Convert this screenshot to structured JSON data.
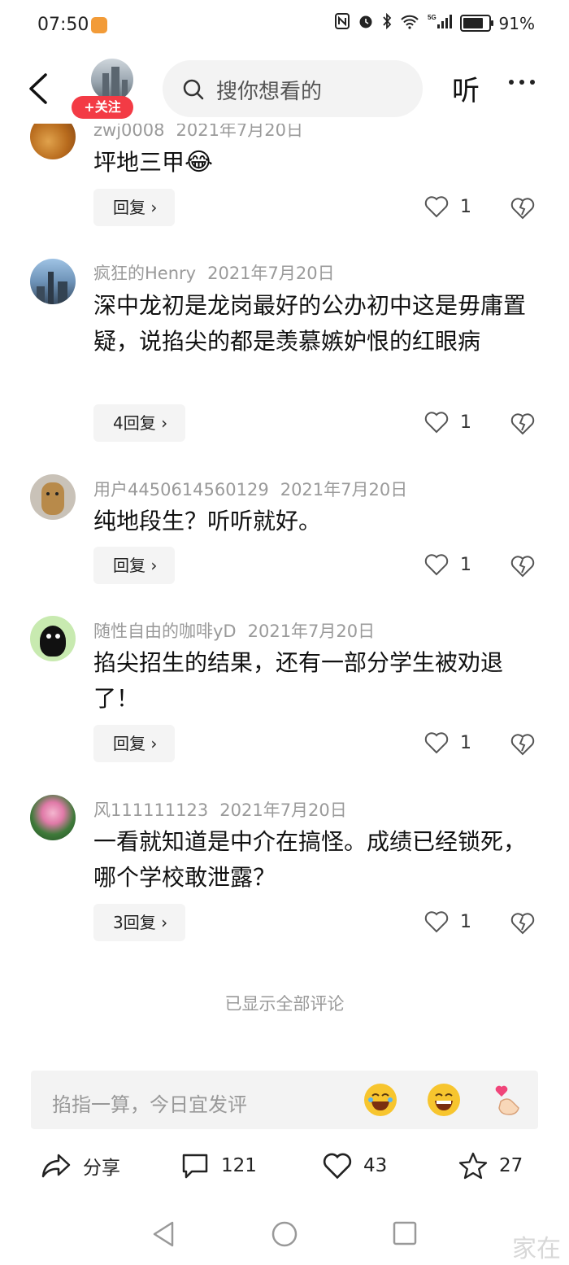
{
  "status_bar": {
    "time": "07:50",
    "battery": "91%",
    "battery_level": 0.91,
    "network": "5G"
  },
  "header": {
    "follow_label": "+关注",
    "search_placeholder": "搜你想看的",
    "listen_label": "听"
  },
  "comments": [
    {
      "user": "zwj0008",
      "date": "2021年7月20日",
      "text": "坪地三甲",
      "reply_label": "回复",
      "likes": "1",
      "emoji": "😂"
    },
    {
      "user": "疯狂的Henry",
      "date": "2021年7月20日",
      "text": "深中龙初是龙岗最好的公办初中这是毋庸置疑，说掐尖的都是羡慕嫉妒恨的红眼病",
      "reply_label": "4回复",
      "likes": "1"
    },
    {
      "user": "用户4450614560129",
      "date": "2021年7月20日",
      "text": "纯地段生？听听就好。",
      "reply_label": "回复",
      "likes": "1"
    },
    {
      "user": "随性自由的咖啡yD",
      "date": "2021年7月20日",
      "text": "掐尖招生的结果，还有一部分学生被劝退了！",
      "reply_label": "回复",
      "likes": "1"
    },
    {
      "user": "风111111123",
      "date": "2021年7月20日",
      "text": "一看就知道是中介在搞怪。成绩已经锁死，哪个学校敢泄露？",
      "reply_label": "3回复",
      "likes": "1"
    }
  ],
  "footer_note": "已显示全部评论",
  "input": {
    "placeholder": "掐指一算，今日宜发评"
  },
  "actions": {
    "share_label": "分享",
    "comments_count": "121",
    "likes_count": "43",
    "favorites_count": "27"
  },
  "watermark": "家在"
}
